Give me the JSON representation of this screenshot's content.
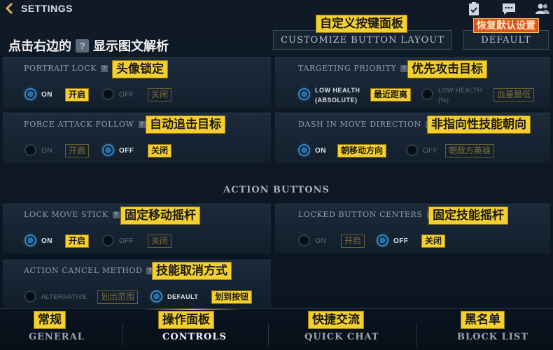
{
  "header": {
    "title": "SETTINGS",
    "icons": [
      "back-icon",
      "clipboard-icon",
      "chat-icon",
      "friends-icon"
    ]
  },
  "page_hint": {
    "before": "点击右边的",
    "icon": "?",
    "after": "显示图文解析"
  },
  "top_buttons": {
    "customize_tag": "自定义按键面板",
    "customize_label": "CUSTOMIZE BUTTON LAYOUT",
    "default_tag": "恢复默认设置",
    "default_label": "DEFAULT"
  },
  "settings": {
    "portrait_lock": {
      "title": "PORTRAIT LOCK",
      "tag": "头像锁定",
      "opt1": "ON",
      "opt1_tag": "开启",
      "opt2": "OFF",
      "opt2_tag": "关闭",
      "selected": "ON"
    },
    "targeting_priority": {
      "title": "TARGETING PRIORITY",
      "tag": "优先攻击目标",
      "opt1_line1": "LOW HEALTH",
      "opt1_line2": "(ABSOLUTE)",
      "opt1_tag": "最近距离",
      "opt2_line1": "LOW HEALTH",
      "opt2_line2": "(%)",
      "opt2_tag": "血量最低",
      "selected": "LOW HEALTH (ABSOLUTE)"
    },
    "force_attack_follow": {
      "title": "FORCE ATTACK FOLLOW",
      "tag": "自动追击目标",
      "opt1": "ON",
      "opt1_tag": "开启",
      "opt2": "OFF",
      "opt2_tag": "关闭",
      "selected": "OFF"
    },
    "dash_in_move_direction": {
      "title": "DASH IN MOVE DIRECTION",
      "tag": "非指向性技能朝向",
      "opt1": "ON",
      "opt1_tag": "朝移动方向",
      "opt2": "OFF",
      "opt2_tag": "朝敌方英雄",
      "selected": "ON"
    },
    "lock_move_stick": {
      "title": "LOCK MOVE STICK",
      "tag": "固定移动摇杆",
      "opt1": "ON",
      "opt1_tag": "开启",
      "opt2": "OFF",
      "opt2_tag": "关闭",
      "selected": "ON"
    },
    "locked_button_centers": {
      "title": "LOCKED BUTTON CENTERS",
      "tag": "固定技能摇杆",
      "opt1": "ON",
      "opt1_tag": "开启",
      "opt2": "OFF",
      "opt2_tag": "关闭",
      "selected": "OFF"
    },
    "action_cancel_method": {
      "title": "ACTION CANCEL METHOD",
      "tag": "技能取消方式",
      "opt1": "ALTERNATIVE",
      "opt1_tag": "划出范围",
      "opt2": "DEFAULT",
      "opt2_tag": "划到按钮",
      "selected": "DEFAULT"
    }
  },
  "section_action_buttons": "ACTION BUTTONS",
  "nav": {
    "general": {
      "label": "GENERAL",
      "tag": "常规"
    },
    "controls": {
      "label": "CONTROLS",
      "tag": "操作面板",
      "active": true
    },
    "quick_chat": {
      "label": "QUICK CHAT",
      "tag": "快捷交流"
    },
    "block_list": {
      "label": "BLOCK LIST",
      "tag": "黑名单"
    }
  },
  "colors": {
    "accent_blue": "#3a89c9",
    "tag_yellow": "#f5cf2e",
    "tag_orange": "#e0531d",
    "background": "#0f1a26"
  }
}
